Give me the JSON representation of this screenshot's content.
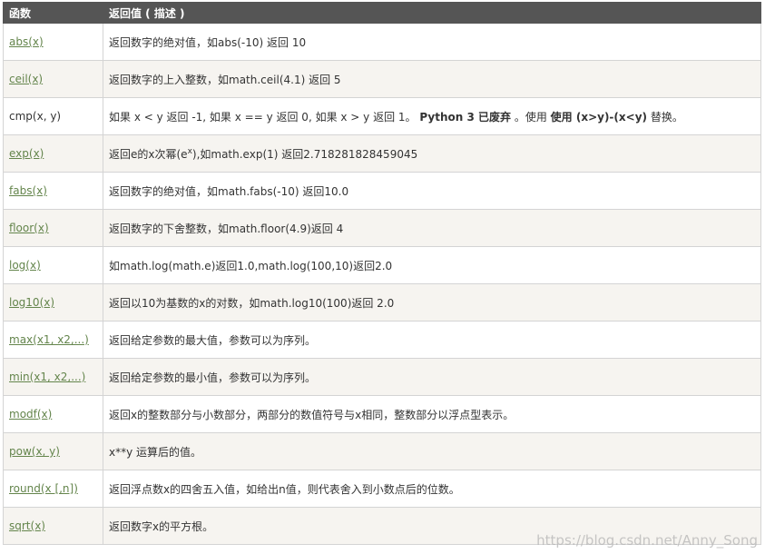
{
  "header": {
    "col_function": "函数",
    "col_desc": "返回值 ( 描述 )"
  },
  "rows": [
    {
      "fn": "abs(x)",
      "link": true,
      "desc": "返回数字的绝对值，如abs(-10) 返回 10"
    },
    {
      "fn": "ceil(x)",
      "link": true,
      "desc": "返回数字的上入整数，如math.ceil(4.1) 返回 5"
    },
    {
      "fn": "cmp(x, y)",
      "link": false,
      "desc_a": "如果 x < y 返回 -1, 如果 x == y 返回 0, 如果 x > y 返回 1。",
      "desc_b": "Python 3 已废弃",
      "desc_c": "。使用",
      "desc_d": "使用 (x>y)-(x<y)",
      "desc_e": "替换。"
    },
    {
      "fn": "exp(x)",
      "link": true,
      "desc_a": "返回e的x次幂(e",
      "desc_sup": "x",
      "desc_b": "),如math.exp(1) 返回2.718281828459045"
    },
    {
      "fn": "fabs(x)",
      "link": true,
      "desc": "返回数字的绝对值，如math.fabs(-10) 返回10.0"
    },
    {
      "fn": "floor(x)",
      "link": true,
      "desc": "返回数字的下舍整数，如math.floor(4.9)返回 4"
    },
    {
      "fn": "log(x)",
      "link": true,
      "desc": "如math.log(math.e)返回1.0,math.log(100,10)返回2.0"
    },
    {
      "fn": "log10(x)",
      "link": true,
      "desc": "返回以10为基数的x的对数，如math.log10(100)返回 2.0"
    },
    {
      "fn": "max(x1, x2,...)",
      "link": true,
      "desc": "返回给定参数的最大值，参数可以为序列。"
    },
    {
      "fn": "min(x1, x2,...)",
      "link": true,
      "desc": "返回给定参数的最小值，参数可以为序列。"
    },
    {
      "fn": "modf(x)",
      "link": true,
      "desc": "返回x的整数部分与小数部分，两部分的数值符号与x相同，整数部分以浮点型表示。"
    },
    {
      "fn": "pow(x, y)",
      "link": true,
      "desc": "x**y 运算后的值。"
    },
    {
      "fn": "round(x [,n])",
      "link": true,
      "desc": "返回浮点数x的四舍五入值，如给出n值，则代表舍入到小数点后的位数。"
    },
    {
      "fn": "sqrt(x)",
      "link": true,
      "desc": "返回数字x的平方根。"
    }
  ],
  "watermark": "https://blog.csdn.net/Anny_Song"
}
